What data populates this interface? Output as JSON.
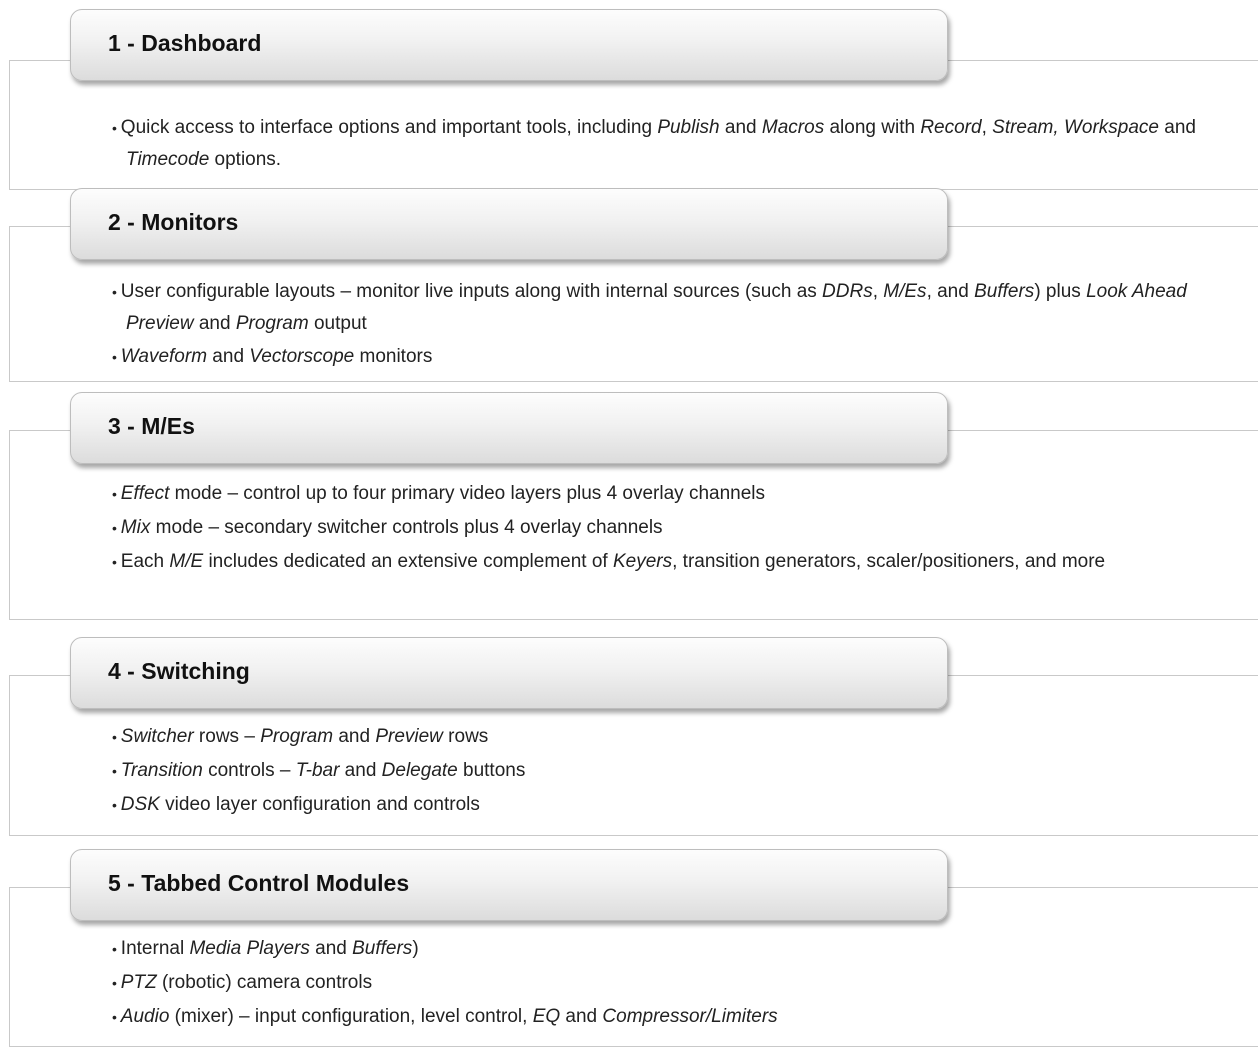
{
  "sections": [
    {
      "title": "1 - Dashboard",
      "bullets": [
        [
          {
            "t": "Quick access to interface options and important tools, including "
          },
          {
            "t": "Publish",
            "i": true
          },
          {
            "t": " and "
          },
          {
            "t": "Macros",
            "i": true
          },
          {
            "t": " along with "
          },
          {
            "t": "Record",
            "i": true
          },
          {
            "t": ", "
          },
          {
            "t": "Stream,",
            "i": true
          },
          {
            "t": " "
          },
          {
            "t": "Workspace",
            "i": true
          },
          {
            "t": " and "
          },
          {
            "t": "Timecode",
            "i": true
          },
          {
            "t": " options."
          }
        ]
      ]
    },
    {
      "title": "2 - Monitors",
      "bullets": [
        [
          {
            "t": "User configurable layouts – monitor live inputs along with internal sources (such as "
          },
          {
            "t": "DDRs",
            "i": true
          },
          {
            "t": ", "
          },
          {
            "t": "M/Es",
            "i": true
          },
          {
            "t": ", and "
          },
          {
            "t": "Buffers",
            "i": true
          },
          {
            "t": ") plus "
          },
          {
            "t": "Look Ahead Preview",
            "i": true
          },
          {
            "t": " and "
          },
          {
            "t": "Program",
            "i": true
          },
          {
            "t": " output"
          }
        ],
        [
          {
            "t": "Waveform",
            "i": true
          },
          {
            "t": " and "
          },
          {
            "t": "Vectorscope",
            "i": true
          },
          {
            "t": "  monitors"
          }
        ]
      ]
    },
    {
      "title": "3 - M/Es",
      "bullets": [
        [
          {
            "t": "Effect",
            "i": true
          },
          {
            "t": " mode – control up to four primary video layers plus 4 overlay channels"
          }
        ],
        [
          {
            "t": "Mix",
            "i": true
          },
          {
            "t": " mode – secondary switcher controls plus 4 overlay channels"
          }
        ],
        [
          {
            "t": "Each "
          },
          {
            "t": "M/E",
            "i": true
          },
          {
            "t": " includes dedicated an extensive complement of "
          },
          {
            "t": "Keyers",
            "i": true
          },
          {
            "t": ",  transition generators, scaler/positioners, and more"
          }
        ]
      ]
    },
    {
      "title": "4 - Switching",
      "bullets": [
        [
          {
            "t": "Switcher",
            "i": true
          },
          {
            "t": " rows – "
          },
          {
            "t": "Program",
            "i": true
          },
          {
            "t": " and "
          },
          {
            "t": "Preview",
            "i": true
          },
          {
            "t": " rows"
          }
        ],
        [
          {
            "t": "Transition",
            "i": true
          },
          {
            "t": " controls – "
          },
          {
            "t": "T-bar",
            "i": true
          },
          {
            "t": " and "
          },
          {
            "t": "Delegate",
            "i": true
          },
          {
            "t": " buttons"
          }
        ],
        [
          {
            "t": "DSK",
            "i": true
          },
          {
            "t": " video layer configuration and controls"
          }
        ]
      ]
    },
    {
      "title": "5 - Tabbed Control Modules",
      "bullets": [
        [
          {
            "t": "Internal  "
          },
          {
            "t": "Media Players",
            "i": true
          },
          {
            "t": " and "
          },
          {
            "t": "Buffers",
            "i": true
          },
          {
            "t": ")"
          }
        ],
        [
          {
            "t": "PTZ",
            "i": true
          },
          {
            "t": " (robotic) camera controls"
          }
        ],
        [
          {
            "t": "Audio",
            "i": true
          },
          {
            "t": " (mixer) – input configuration, level control, "
          },
          {
            "t": "EQ",
            "i": true
          },
          {
            "t": " and "
          },
          {
            "t": "Compressor/Limiters",
            "i": true
          }
        ]
      ]
    }
  ]
}
